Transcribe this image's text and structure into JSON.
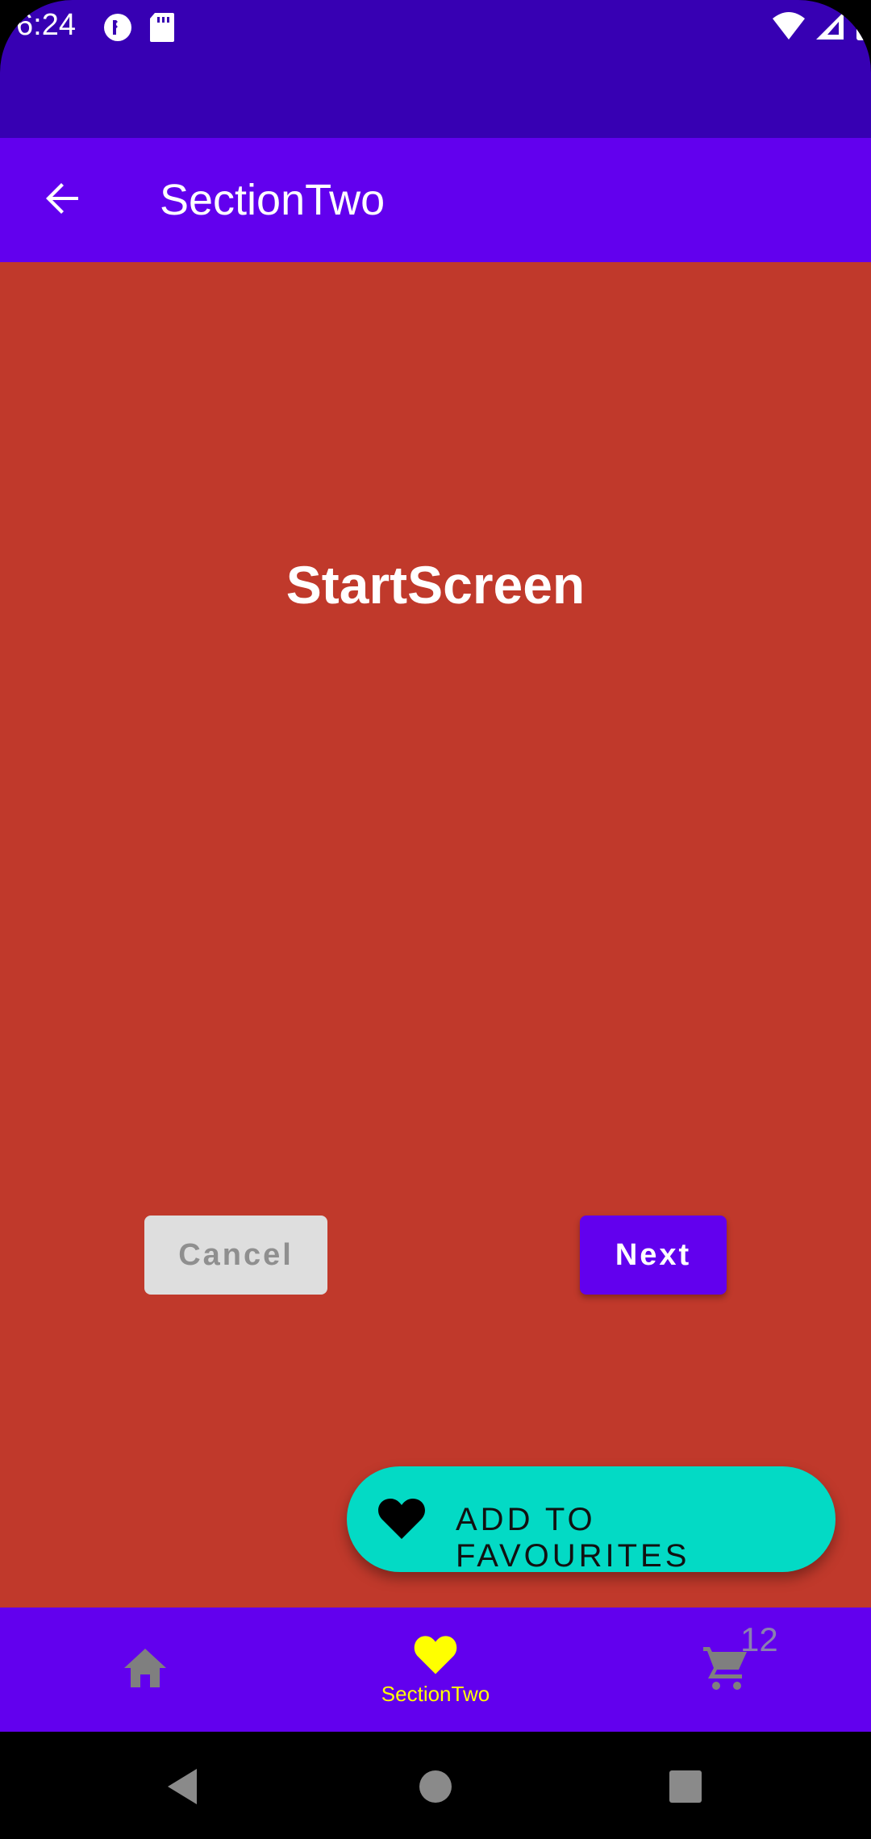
{
  "status_bar": {
    "time": "6:24",
    "background": "#3700b3",
    "icons_left": [
      "data-saver-icon",
      "sd-card-icon"
    ],
    "icons_right": [
      "wifi-icon",
      "cellular-signal-icon",
      "battery-icon"
    ]
  },
  "app_bar": {
    "title": "SectionTwo",
    "background": "#6200ee",
    "back_icon": "arrow-back-icon"
  },
  "content": {
    "background": "#c0392b",
    "title": "StartScreen",
    "cancel_label": "Cancel",
    "next_label": "Next"
  },
  "fab": {
    "label": "ADD TO FAVOURITES",
    "icon": "heart-icon",
    "background": "#03dac5"
  },
  "bottom_nav": {
    "background": "#6200ee",
    "items": [
      {
        "icon": "home-icon",
        "label": "",
        "selected": false
      },
      {
        "icon": "heart-icon",
        "label": "SectionTwo",
        "selected": true
      },
      {
        "icon": "cart-icon",
        "label": "",
        "selected": false,
        "badge": "12"
      }
    ],
    "active_color": "#ffff00",
    "inactive_color": "#7f7f7f"
  },
  "system_nav": {
    "buttons": [
      "back-triangle-icon",
      "home-circle-icon",
      "recents-square-icon"
    ]
  }
}
